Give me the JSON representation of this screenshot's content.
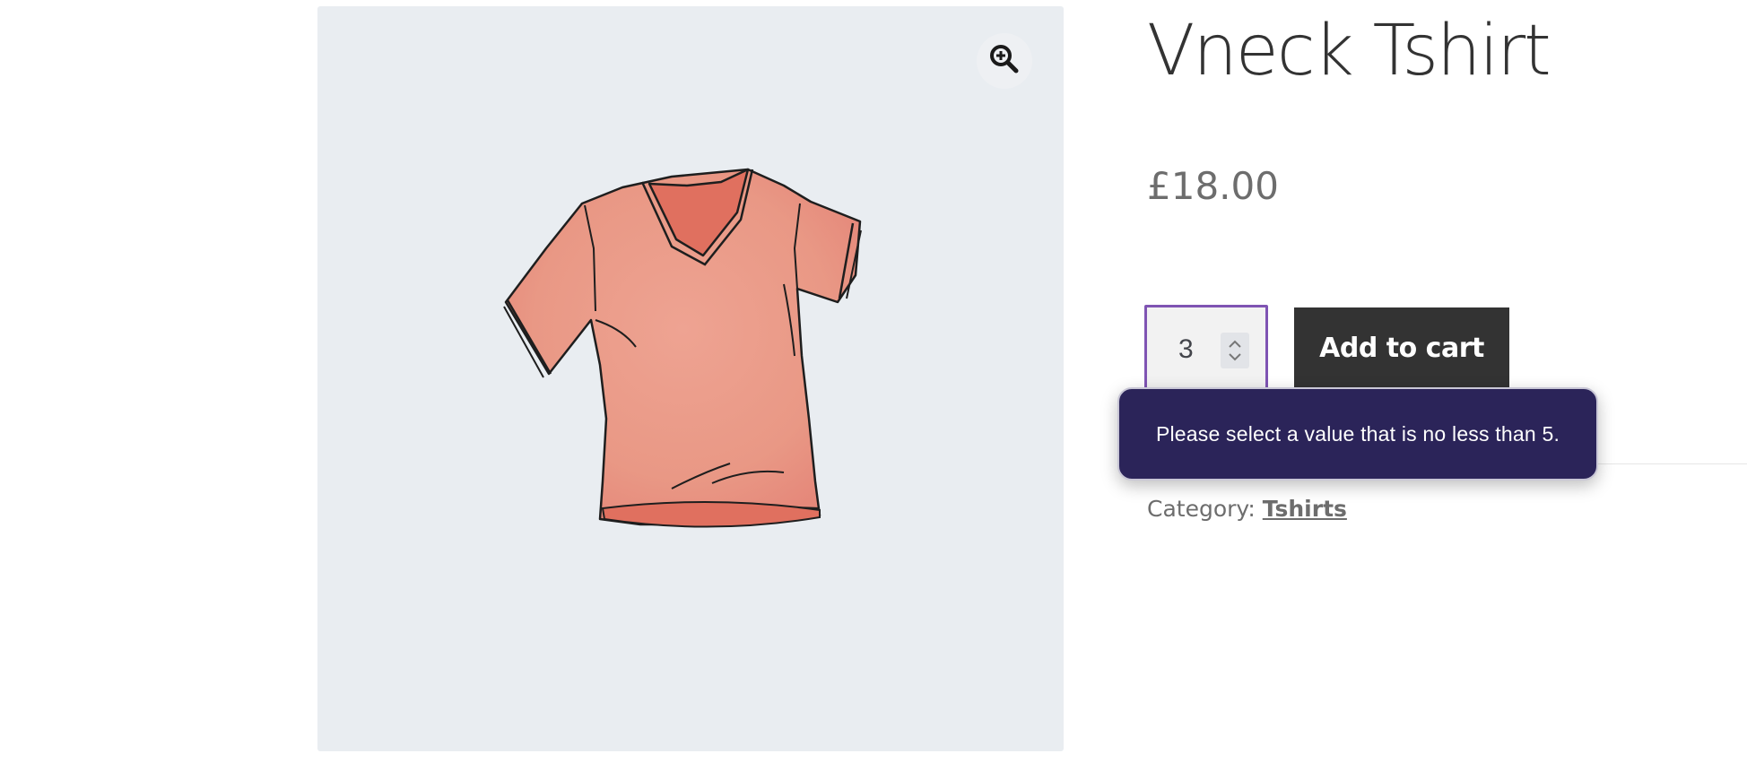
{
  "product": {
    "title": "Vneck Tshirt",
    "price": "£18.00",
    "image_alt": "Vneck Tshirt",
    "quantity": "3",
    "add_to_cart_label": "Add to cart",
    "category_label": "Category:",
    "category_link": "Tshirts"
  },
  "validation": {
    "message": "Please select a value that is no less than 5."
  },
  "colors": {
    "gallery_background": "#e9edf1",
    "button_background": "#333333",
    "focus_outline": "#7f54b3",
    "tooltip_background": "#2b2459"
  },
  "icons": {
    "zoom": "zoom-in-icon",
    "stepper": "chevron-up-down-icon"
  }
}
